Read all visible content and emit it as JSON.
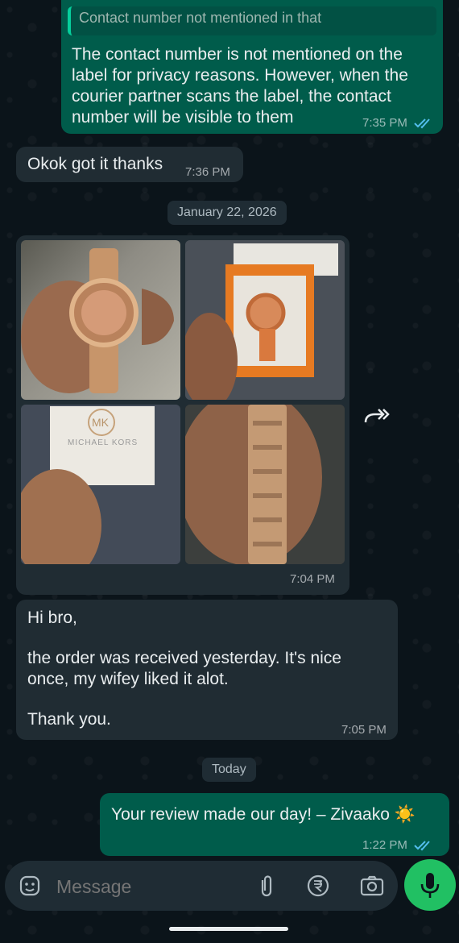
{
  "messages": {
    "m1": {
      "quote": "Contact number not mentioned in that",
      "line1": "The contact number is not mentioned on the",
      "line2": "label for privacy reasons. However, when the",
      "line3": "courier partner scans the label, the contact",
      "line4": "number will be visible to them",
      "time": "7:35 PM"
    },
    "m2": {
      "text": "Okok got it thanks",
      "time": "7:36 PM"
    },
    "date1": "January 22, 2026",
    "media": {
      "time": "7:04 PM",
      "photo_brand": "MICHAEL KORS",
      "photo_logo": "MK"
    },
    "m3": {
      "line1": "Hi bro,",
      "line2": "the order was received yesterday. It's nice",
      "line3": "once, my wifey liked it alot.",
      "line4": "Thank you.",
      "time": "7:05 PM"
    },
    "date2": "Today",
    "m4": {
      "text": "Your review made our day! – Zivaako",
      "emoji": "☀️",
      "time": "1:22 PM"
    }
  },
  "input": {
    "placeholder": "Message"
  },
  "colors": {
    "outgoing": "#005c4b",
    "incoming": "#202c33",
    "accent": "#21c063",
    "read_ticks": "#53bdeb"
  }
}
